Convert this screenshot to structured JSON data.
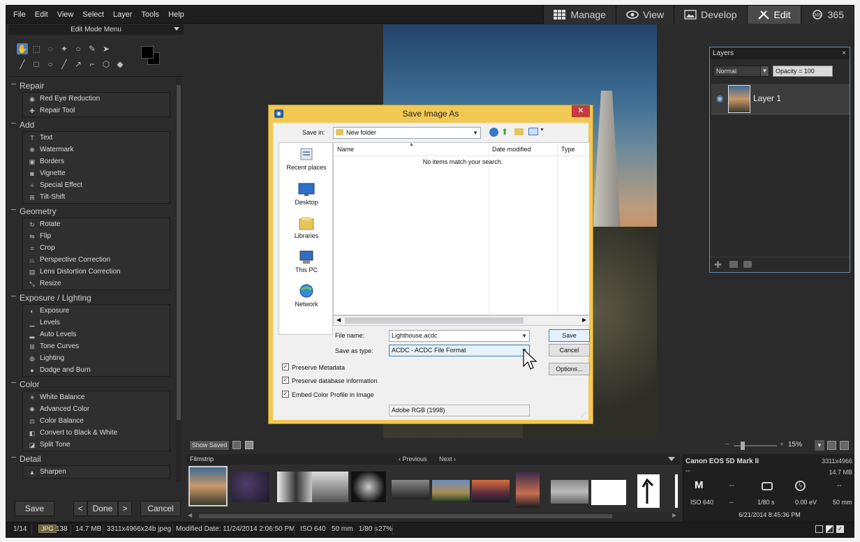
{
  "menubar": {
    "menus": [
      "File",
      "Edit",
      "View",
      "Select",
      "Layer",
      "Tools",
      "Help"
    ],
    "modes": [
      {
        "label": "Manage",
        "icon": "grid-icon"
      },
      {
        "label": "View",
        "icon": "eye-icon"
      },
      {
        "label": "Develop",
        "icon": "image-icon"
      },
      {
        "label": "Edit",
        "icon": "tools-icon",
        "active": true
      },
      {
        "label": "365",
        "icon": "365-icon"
      }
    ]
  },
  "left_panel": {
    "header": "Edit Mode Menu",
    "sections": [
      {
        "title": "Repair",
        "items": [
          "Red Eye Reduction",
          "Repair Tool"
        ]
      },
      {
        "title": "Add",
        "items": [
          "Text",
          "Watermark",
          "Borders",
          "Vignette",
          "Special Effect",
          "Tilt-Shift"
        ]
      },
      {
        "title": "Geometry",
        "items": [
          "Rotate",
          "Flip",
          "Crop",
          "Perspective Correction",
          "Lens Distortion Correction",
          "Resize"
        ]
      },
      {
        "title": "Exposure / Lighting",
        "items": [
          "Exposure",
          "Levels",
          "Auto Levels",
          "Tone Curves",
          "Lighting",
          "Dodge and Burn"
        ]
      },
      {
        "title": "Color",
        "items": [
          "White Balance",
          "Advanced Color",
          "Color Balance",
          "Convert to Black & White",
          "Split Tone"
        ]
      },
      {
        "title": "Detail",
        "items": [
          "Sharpen"
        ]
      }
    ],
    "buttons": {
      "save": "Save",
      "done": "Done",
      "cancel": "Cancel",
      "prev": "<",
      "next": ">"
    }
  },
  "layers": {
    "title": "Layers",
    "close": "×",
    "blend_mode": "Normal",
    "opacity": "Opacity = 100",
    "layer_name": "Layer 1"
  },
  "dialog": {
    "title": "Save Image As",
    "close": "✕",
    "save_in_label": "Save in:",
    "save_in_value": "New folder",
    "places": [
      "Recent places",
      "Desktop",
      "Libraries",
      "This PC",
      "Network"
    ],
    "columns": [
      "Name",
      "Date modified",
      "Type"
    ],
    "empty_message": "No items match your search.",
    "file_name_label": "File name:",
    "file_name_value": "Lighthouse.acdc",
    "save_type_label": "Save as type:",
    "save_type_value": "ACDC - ACDC File Format",
    "buttons": {
      "save": "Save",
      "cancel": "Cancel",
      "options": "Options..."
    },
    "checkboxes": [
      {
        "label": "Preserve Metadata",
        "checked": true
      },
      {
        "label": "Preserve database information",
        "checked": true
      },
      {
        "label": "Embed Color Profile in Image",
        "checked": true
      }
    ],
    "color_profile": "Adobe RGB (1998)"
  },
  "canvas_bar": {
    "show_saved": "Show Saved",
    "zoom": "15%"
  },
  "filmstrip": {
    "title": "Filmstrip",
    "previous": "Previous",
    "next": "Next"
  },
  "info": {
    "camera": "Canon EOS 5D Mark II",
    "dimensions": "3311x4966",
    "dash": "--",
    "size": "14.7 MB",
    "mode": "M",
    "iso": "ISO 640",
    "shutter": "1/80 s",
    "ev": "0.00 eV",
    "focal": "50 mm",
    "date": "6/21/2014 8:45:36 PM"
  },
  "status": {
    "position": "1/14",
    "format": "JPG",
    "number": "138",
    "filesize": "14.7 MB",
    "details": "3311x4966x24b jpeg",
    "modified": "Modified Date: 11/24/2014 2:06:50 PM",
    "exif": "ISO 640   50 mm   1/80 s",
    "zoom": "27%"
  }
}
